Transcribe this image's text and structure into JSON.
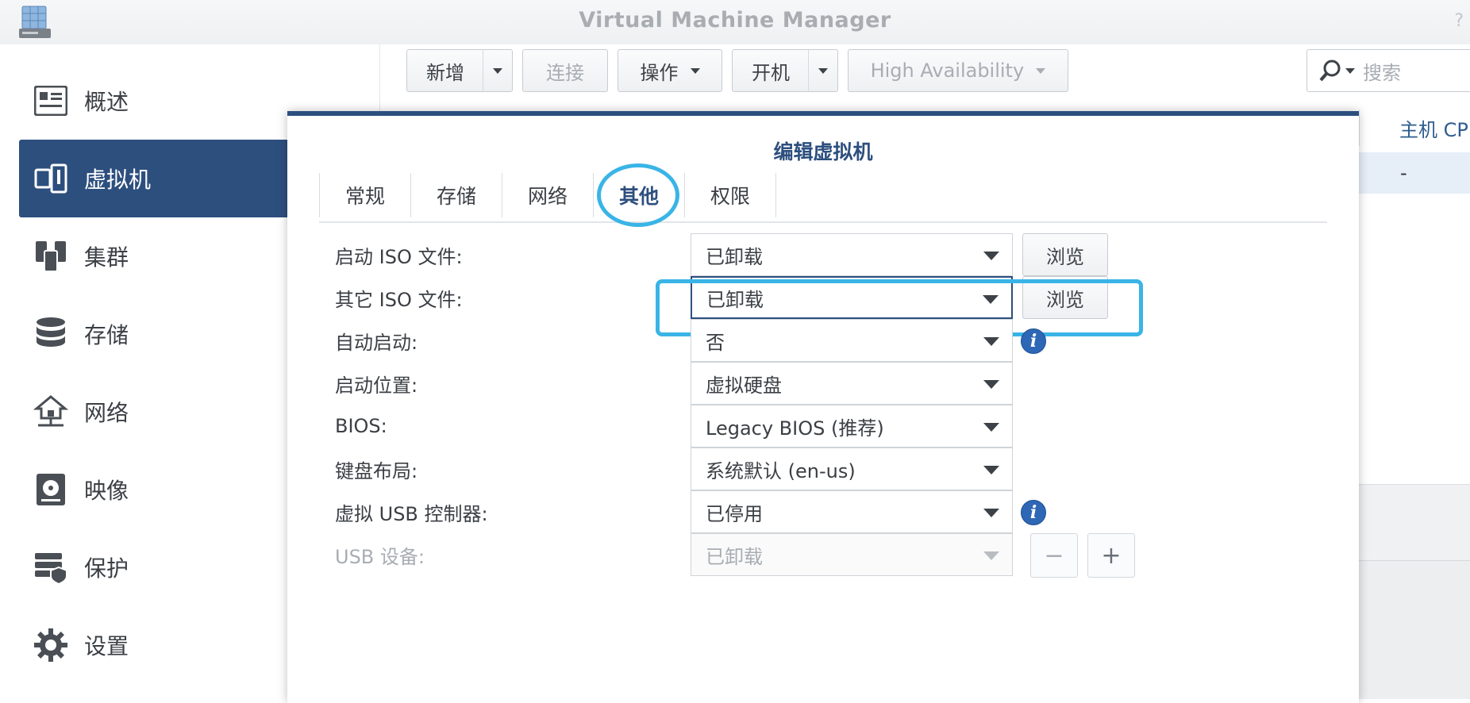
{
  "window": {
    "title": "Virtual Machine Manager",
    "help": "?"
  },
  "sidebar": {
    "items": [
      {
        "label": "概述",
        "icon": "overview-icon"
      },
      {
        "label": "虚拟机",
        "icon": "virtual-machine-icon",
        "active": true
      },
      {
        "label": "集群",
        "icon": "cluster-icon"
      },
      {
        "label": "存储",
        "icon": "storage-icon"
      },
      {
        "label": "网络",
        "icon": "network-icon"
      },
      {
        "label": "映像",
        "icon": "image-icon"
      },
      {
        "label": "保护",
        "icon": "protection-icon"
      },
      {
        "label": "设置",
        "icon": "settings-icon"
      }
    ]
  },
  "toolbar": {
    "new_label": "新增",
    "connect_label": "连接",
    "action_label": "操作",
    "power_on_label": "开机",
    "ha_label": "High Availability",
    "search_placeholder": "搜索"
  },
  "table": {
    "column_host_cpu": "主机 CP",
    "row_value": "-"
  },
  "modal": {
    "title": "编辑虚拟机",
    "tabs": [
      "常规",
      "存储",
      "网络",
      "其他",
      "权限"
    ],
    "active_tab": "其他",
    "fields": {
      "boot_iso": {
        "label": "启动 ISO 文件:",
        "value": "已卸载",
        "button": "浏览"
      },
      "other_iso": {
        "label": "其它 ISO 文件:",
        "value": "已卸载",
        "button": "浏览"
      },
      "autostart": {
        "label": "自动启动:",
        "value": "否"
      },
      "boot_from": {
        "label": "启动位置:",
        "value": "虚拟硬盘"
      },
      "bios": {
        "label": "BIOS:",
        "value": "Legacy BIOS (推荐)"
      },
      "keyboard": {
        "label": "键盘布局:",
        "value": "系统默认 (en-us)"
      },
      "usb_controller": {
        "label": "虚拟 USB 控制器:",
        "value": "已停用"
      },
      "usb_device": {
        "label": "USB 设备:",
        "value": "已卸载"
      }
    },
    "info_glyph": "i",
    "minus_glyph": "−",
    "plus_glyph": "+"
  },
  "colors": {
    "accent": "#2d4f7e",
    "highlight": "#3ab4e6",
    "info": "#2e67b5"
  }
}
